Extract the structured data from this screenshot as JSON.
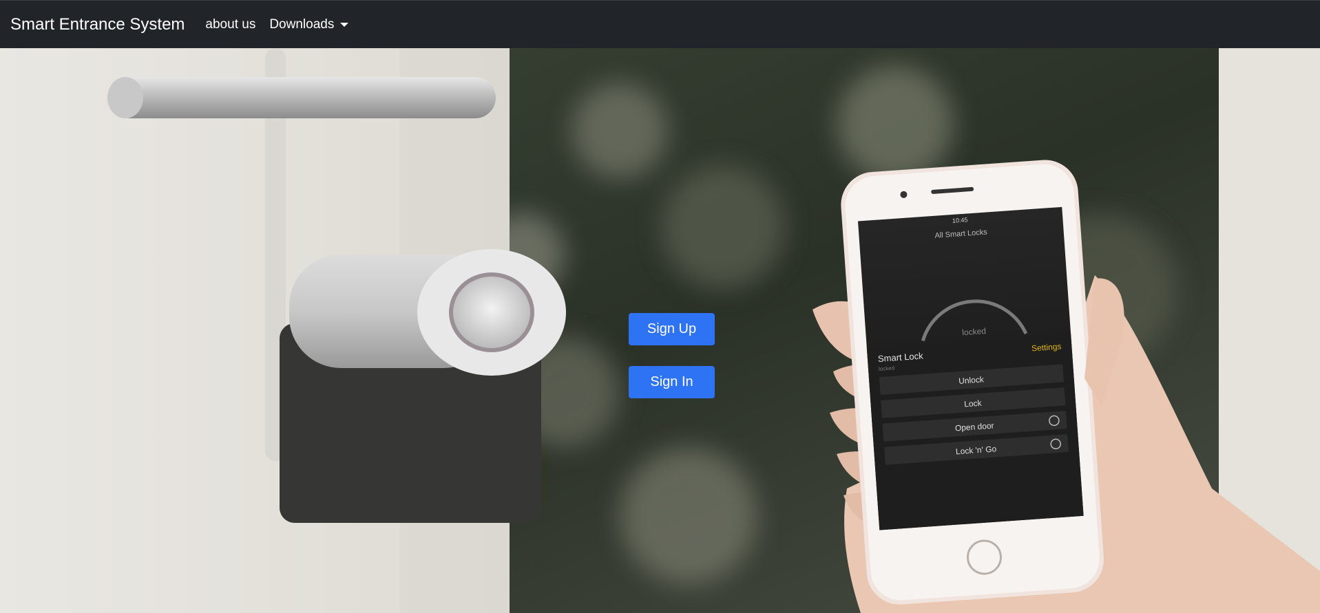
{
  "navbar": {
    "brand": "Smart Entrance System",
    "links": [
      {
        "label": "about us"
      },
      {
        "label": "Downloads",
        "icon": "caret-down-icon"
      }
    ]
  },
  "hero": {
    "signup_label": "Sign Up",
    "signin_label": "Sign In",
    "photo_texts": {
      "status_time": "10:45",
      "screen_title": "All Smart Locks",
      "dial_status": "locked",
      "lock_name": "Smart Lock",
      "lock_sub": "locked",
      "settings": "Settings",
      "actions": [
        "Unlock",
        "Lock",
        "Open door",
        "Lock 'n' Go"
      ]
    }
  },
  "colors": {
    "navbar_bg": "#212529",
    "button_bg": "#2f73f5",
    "settings_text": "#e0b40a"
  }
}
